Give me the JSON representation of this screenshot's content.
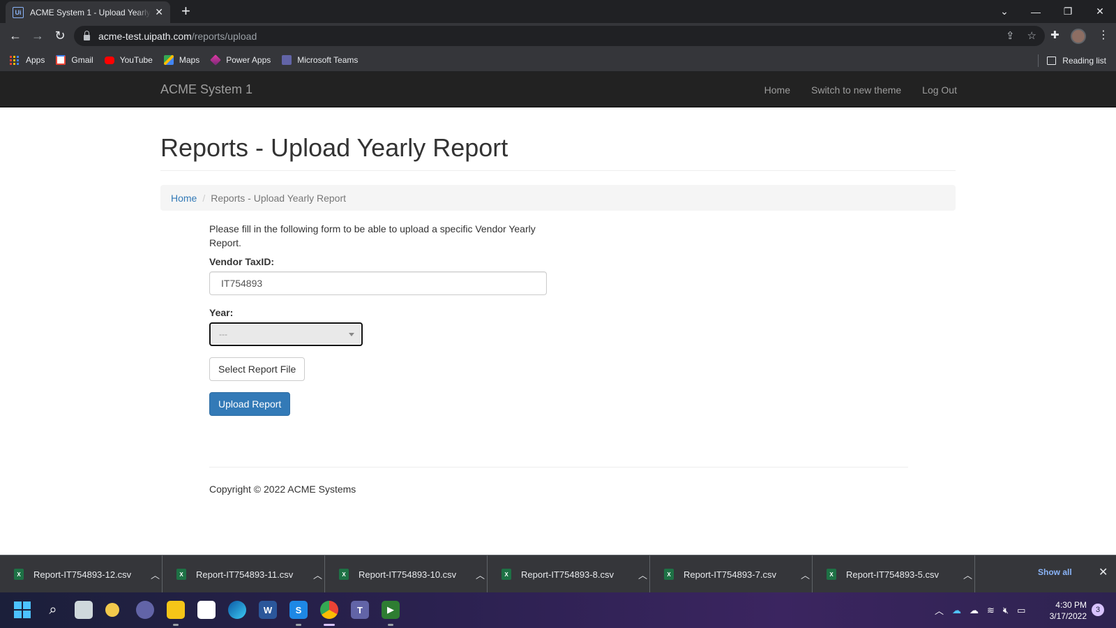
{
  "browser": {
    "tab_title": "ACME System 1 - Upload Yearly Report",
    "favicon_text": "Ui",
    "url_host": "acme-test.uipath.com",
    "url_path": "/reports/upload",
    "bookmarks": [
      "Apps",
      "Gmail",
      "YouTube",
      "Maps",
      "Power Apps",
      "Microsoft Teams"
    ],
    "reading_list": "Reading list"
  },
  "app": {
    "brand": "ACME System 1",
    "nav": [
      "Home",
      "Switch to new theme",
      "Log Out"
    ]
  },
  "page": {
    "title": "Reports - Upload Yearly Report",
    "breadcrumb_home": "Home",
    "breadcrumb_sep": "/",
    "breadcrumb_current": "Reports - Upload Yearly Report",
    "intro": "Please fill in the following form to be able to upload a specific Vendor Yearly Report.",
    "vendor_label": "Vendor TaxID:",
    "vendor_value": "IT754893",
    "year_label": "Year:",
    "year_value": "---",
    "select_file_label": "Select Report File",
    "upload_label": "Upload Report",
    "copyright": "Copyright © 2022 ACME Systems"
  },
  "downloads": {
    "items": [
      "Report-IT754893-12.csv",
      "Report-IT754893-11.csv",
      "Report-IT754893-10.csv",
      "Report-IT754893-8.csv",
      "Report-IT754893-7.csv",
      "Report-IT754893-5.csv"
    ],
    "show_all": "Show all"
  },
  "taskbar": {
    "time": "4:30 PM",
    "date": "3/17/2022",
    "notifications": "3"
  },
  "colors": {
    "navbar_bg": "#222222",
    "primary": "#337ab7",
    "link": "#337ab7"
  }
}
